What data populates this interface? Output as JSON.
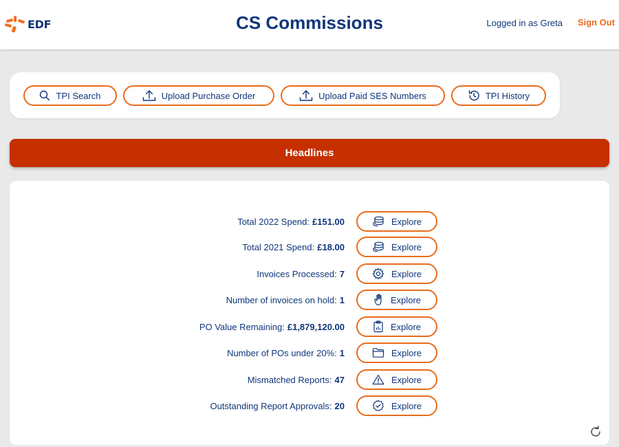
{
  "header": {
    "logo_text": "EDF",
    "title": "CS Commissions",
    "user_text": "Logged in as Greta",
    "signout_label": "Sign Out"
  },
  "toolbar": {
    "buttons": [
      {
        "label": "TPI Search",
        "icon": "search-icon"
      },
      {
        "label": "Upload Purchase Order",
        "icon": "upload-icon"
      },
      {
        "label": "Upload Paid SES Numbers",
        "icon": "upload-icon"
      },
      {
        "label": "TPI History",
        "icon": "history-icon"
      }
    ]
  },
  "headlines": {
    "title": "Headlines",
    "explore_label": "Explore",
    "metrics": [
      {
        "label": "Total 2022 Spend:",
        "value": "£151.00",
        "icon": "coins-icon"
      },
      {
        "label": "Total 2021 Spend:",
        "value": "£18.00",
        "icon": "coins-icon"
      },
      {
        "label": "Invoices Processed:",
        "value": "7",
        "icon": "gear-icon"
      },
      {
        "label": "Number of invoices on hold:",
        "value": "1",
        "icon": "hand-icon"
      },
      {
        "label": "PO Value Remaining:",
        "value": "£1,879,120.00",
        "icon": "clipboard-chart-icon"
      },
      {
        "label": "Number of POs under 20%:",
        "value": "1",
        "icon": "folder-icon"
      },
      {
        "label": "Mismatched Reports:",
        "value": "47",
        "icon": "warning-icon"
      },
      {
        "label": "Outstanding Report Approvals:",
        "value": "20",
        "icon": "badge-icon"
      }
    ]
  },
  "colors": {
    "accent": "#e86c1d",
    "banner": "#c62f00",
    "text": "#10367a",
    "background": "#e9e9e9"
  }
}
